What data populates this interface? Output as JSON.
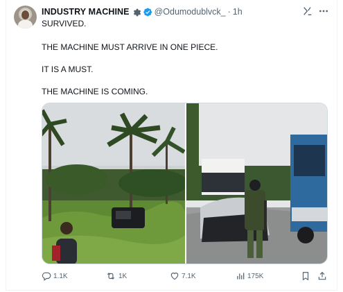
{
  "post": {
    "author_name": "INDUSTRY MACHINE",
    "handle": "@Odumodublvck_",
    "separator": "·",
    "time": "1h",
    "text_lines": [
      "SURVIVED.",
      "THE MACHINE MUST ARRIVE IN ONE PIECE.",
      "IT IS A MUST.",
      "THE MACHINE IS COMING."
    ],
    "icons": [
      "gear-icon",
      "verified-badge-icon",
      "grok-icon",
      "more-icon"
    ]
  },
  "media": {
    "photos": [
      "crashed car in roadside bush",
      "crashed car beside truck with soldier"
    ]
  },
  "actions": {
    "replies": "1.1K",
    "reposts": "1K",
    "likes": "7.1K",
    "views": "175K"
  },
  "colors": {
    "text": "#0f1419",
    "secondary": "#536471",
    "verified": "#1d9bf0",
    "border": "#cfd9de"
  }
}
